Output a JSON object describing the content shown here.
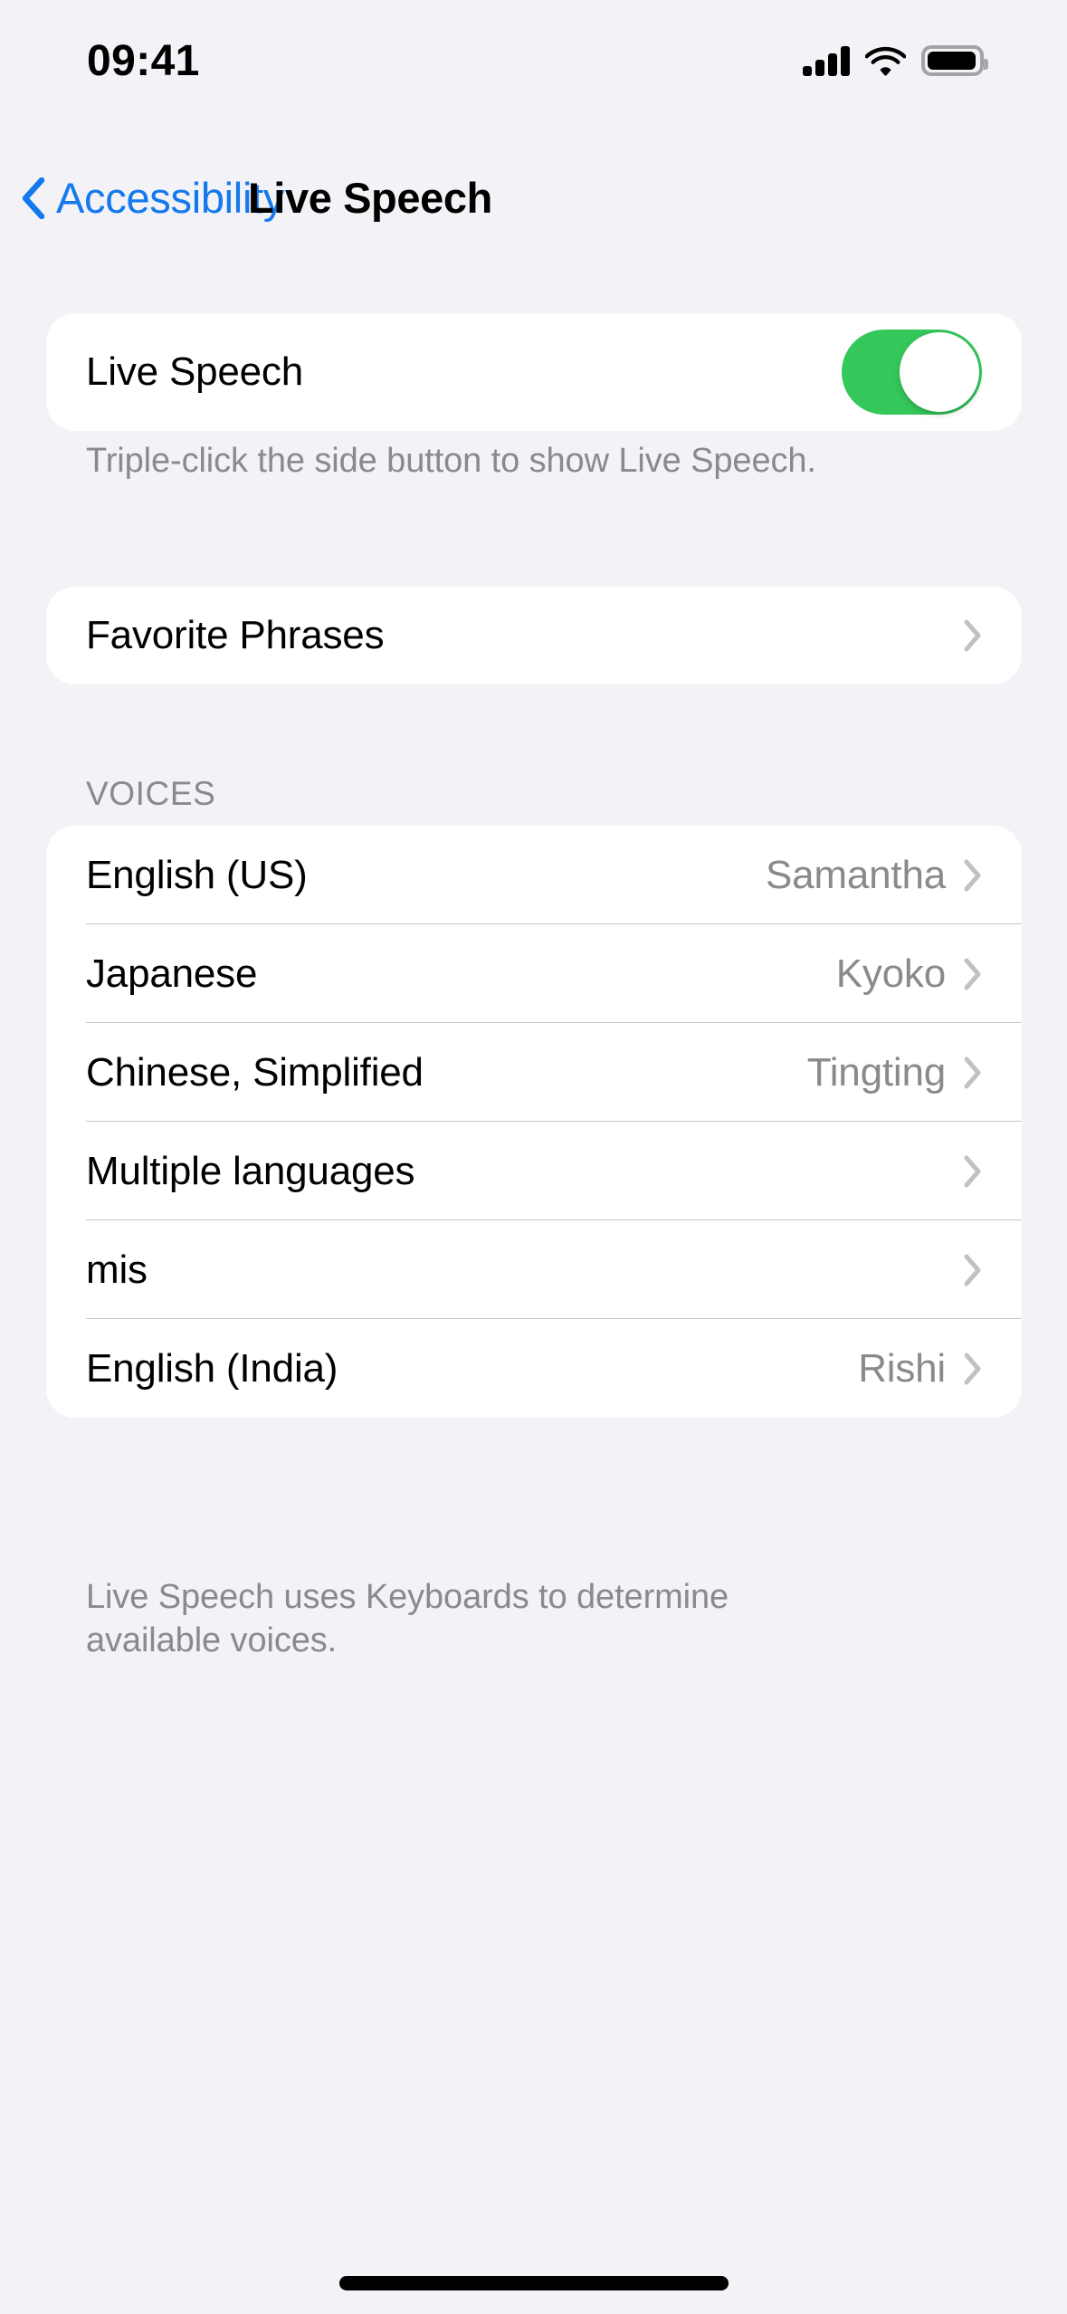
{
  "status_bar": {
    "time": "09:41",
    "cellular_icon": "cellular-signal-icon",
    "wifi_icon": "wifi-icon",
    "battery_icon": "battery-icon"
  },
  "nav": {
    "back_label": "Accessibility",
    "back_icon": "chevron-left-icon",
    "title": "Live Speech"
  },
  "sections": {
    "live_speech": {
      "row_label": "Live Speech",
      "toggle_on": true,
      "toggle_color": "#34C759",
      "footer": "Triple-click the side button to show Live Speech."
    },
    "favorite_phrases": {
      "row_label": "Favorite Phrases"
    },
    "voices": {
      "header": "VOICES",
      "rows": [
        {
          "label": "English (US)",
          "value": "Samantha"
        },
        {
          "label": "Japanese",
          "value": "Kyoko"
        },
        {
          "label": "Chinese, Simplified",
          "value": "Tingting"
        },
        {
          "label": "Multiple languages",
          "value": ""
        },
        {
          "label": "mis",
          "value": ""
        },
        {
          "label": "English (India)",
          "value": "Rishi"
        }
      ],
      "footer": "Live Speech uses Keyboards to determine available voices."
    }
  },
  "colors": {
    "background": "#F2F2F7",
    "card": "#FFFFFF",
    "accent_blue": "#1479EC",
    "toggle_green": "#34C759",
    "secondary_text": "#8A8A8E",
    "separator": "#C6C6C8"
  },
  "home_indicator": "home-indicator"
}
